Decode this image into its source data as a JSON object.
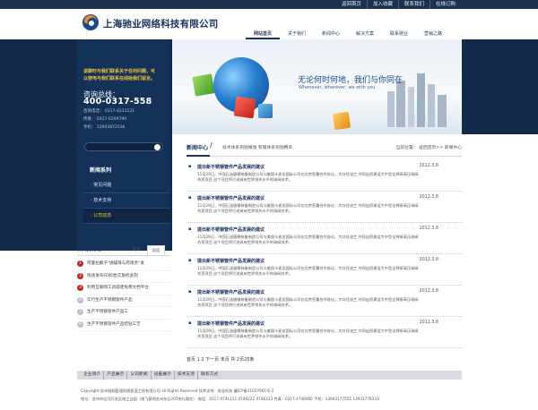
{
  "topbar": {
    "links": [
      "返回首页",
      "加入收藏",
      "联系我们",
      "在线订购"
    ]
  },
  "header": {
    "company_name": "上海驰业网络科技有限公司",
    "nav": [
      "网站首页",
      "关于我们",
      "新闻中心",
      "解决方案",
      "联系驰业",
      "营销之路"
    ],
    "active_nav": 0
  },
  "left": {
    "promo_lines": [
      "谈聊时与我们联系关于任何问题，可",
      "以使电与我们联系在线给我们留言。"
    ],
    "hotline_label": "咨询总线：",
    "hotline": "400-0317-558",
    "contacts": [
      "咨询电话：  0317-4211121",
      "传真：  0317-6299799",
      "手机：  13903872536"
    ],
    "section_title": "新闻系列",
    "menu": [
      "常见问题",
      "技术支持",
      "公司动态"
    ],
    "active_menu": 2
  },
  "banner": {
    "slogan": "无论何时何地，我们与你同在",
    "sub": "Whenever, wherever, we with you"
  },
  "crumb": {
    "title": "新闻中心",
    "sep": "/",
    "sub": "技术体系到驰耀驰 管服体系到驰腾声",
    "location": "当前位置：  返回首页>>  新闻中心"
  },
  "news": {
    "items": [
      {
        "title": "提出新不锈钢管件产品发展的建议",
        "date": "2012.3.8",
        "body": "11月29日，中国石油唐穆装备制造公司与美国卡麦龙国际公司在北京签署合作协议，大口径油兰 共同出资建设大中型全焊接高压球阀合资项目 这个项目将引进具有世界领先水平的球阀技术。"
      },
      {
        "title": "提出新不锈钢管件产品发展的建议",
        "date": "2012.3.8",
        "body": "11月29日，中国石油唐穆装备制造公司与美国卡麦龙国际公司在北京签署合作协议，大口径油兰 共同出资建设大中型全焊接高压球阀合资项目 这个项目将引进具有世界领先水平的球阀技术。"
      },
      {
        "title": "提出新不锈钢管件产品发展的建议",
        "date": "2012.3.8",
        "body": "11月29日，中国石油唐穆装备制造公司与美国卡麦龙国际公司在北京签署合作协议，大口径油兰 共同出资建设大中型全焊接高压球阀合资项目 这个项目将引进具有世界领先水平的球阀技术。"
      },
      {
        "title": "提出新不锈钢管件产品发展的建议",
        "date": "2012.3.8",
        "body": "11月29日，中国石油唐穆装备制造公司与美国卡麦龙国际公司在北京签署合作协议，大口径油兰 共同出资建设大中型全焊接高压球阀合资项目 这个项目将引进具有世界领先水平的球阀技术。"
      },
      {
        "title": "提出新不锈钢管件产品发展的建议",
        "date": "2012.3.8",
        "body": "11月29日，中国石油唐穆装备制造公司与美国卡麦龙国际公司在北京签署合作协议，大口径油兰 共同出资建设大中型全焊接高压球阀合资项目 这个项目将引进具有世界领先水平的球阀技术。"
      },
      {
        "title": "提出新不锈钢管件产品发展的建议",
        "date": "2012.3.8",
        "body": "11月29日，中国石油唐穆装备制造公司与美国卡麦龙国际公司在北京签署合作协议，大口径油兰 共同出资建设大中型全焊接高压球阀合资项目 这个项目将引进具有世界领先水平的球阀技术。"
      }
    ]
  },
  "pagination": "首页  1  2  下一页  末页  共  2页25条",
  "rank": {
    "title": "新闻排行榜",
    "tabs": [
      "技术",
      "动态"
    ],
    "items": [
      "阿曼拉翻子\"抛锚珠与有限责\"发",
      "快速发布FD轮胎实施机会刻",
      "利用互联网工具提建免费文档平台",
      "实行生产不锈钢管件产品",
      "生产不锈钢管件产品工",
      "生产不锈钢管件产品结钻工艺"
    ]
  },
  "footer": {
    "nav": [
      "企业简介",
      "产品展示",
      "公司新闻",
      "设备展示",
      "技术支持",
      "联系方式"
    ],
    "copyright": "Copyright 沧州驰翔管道防腐保温工程有限公司 all Rights Reserved  技术支持：驰业科技          冀ICP备11027061号-2",
    "address": "地址：沧州市运河开发区驰工业园（驰飞基地沧州东区207东行路北）  电话：0317-4741111 4746222 4746333  传真：0317-4746000  手机：13903177555 13931778333"
  },
  "colors": {
    "navy": "#1a3360",
    "dark_bg": "#112a4a",
    "accent_yellow": "#f0c23a",
    "rank_red": "#b82b2b"
  }
}
